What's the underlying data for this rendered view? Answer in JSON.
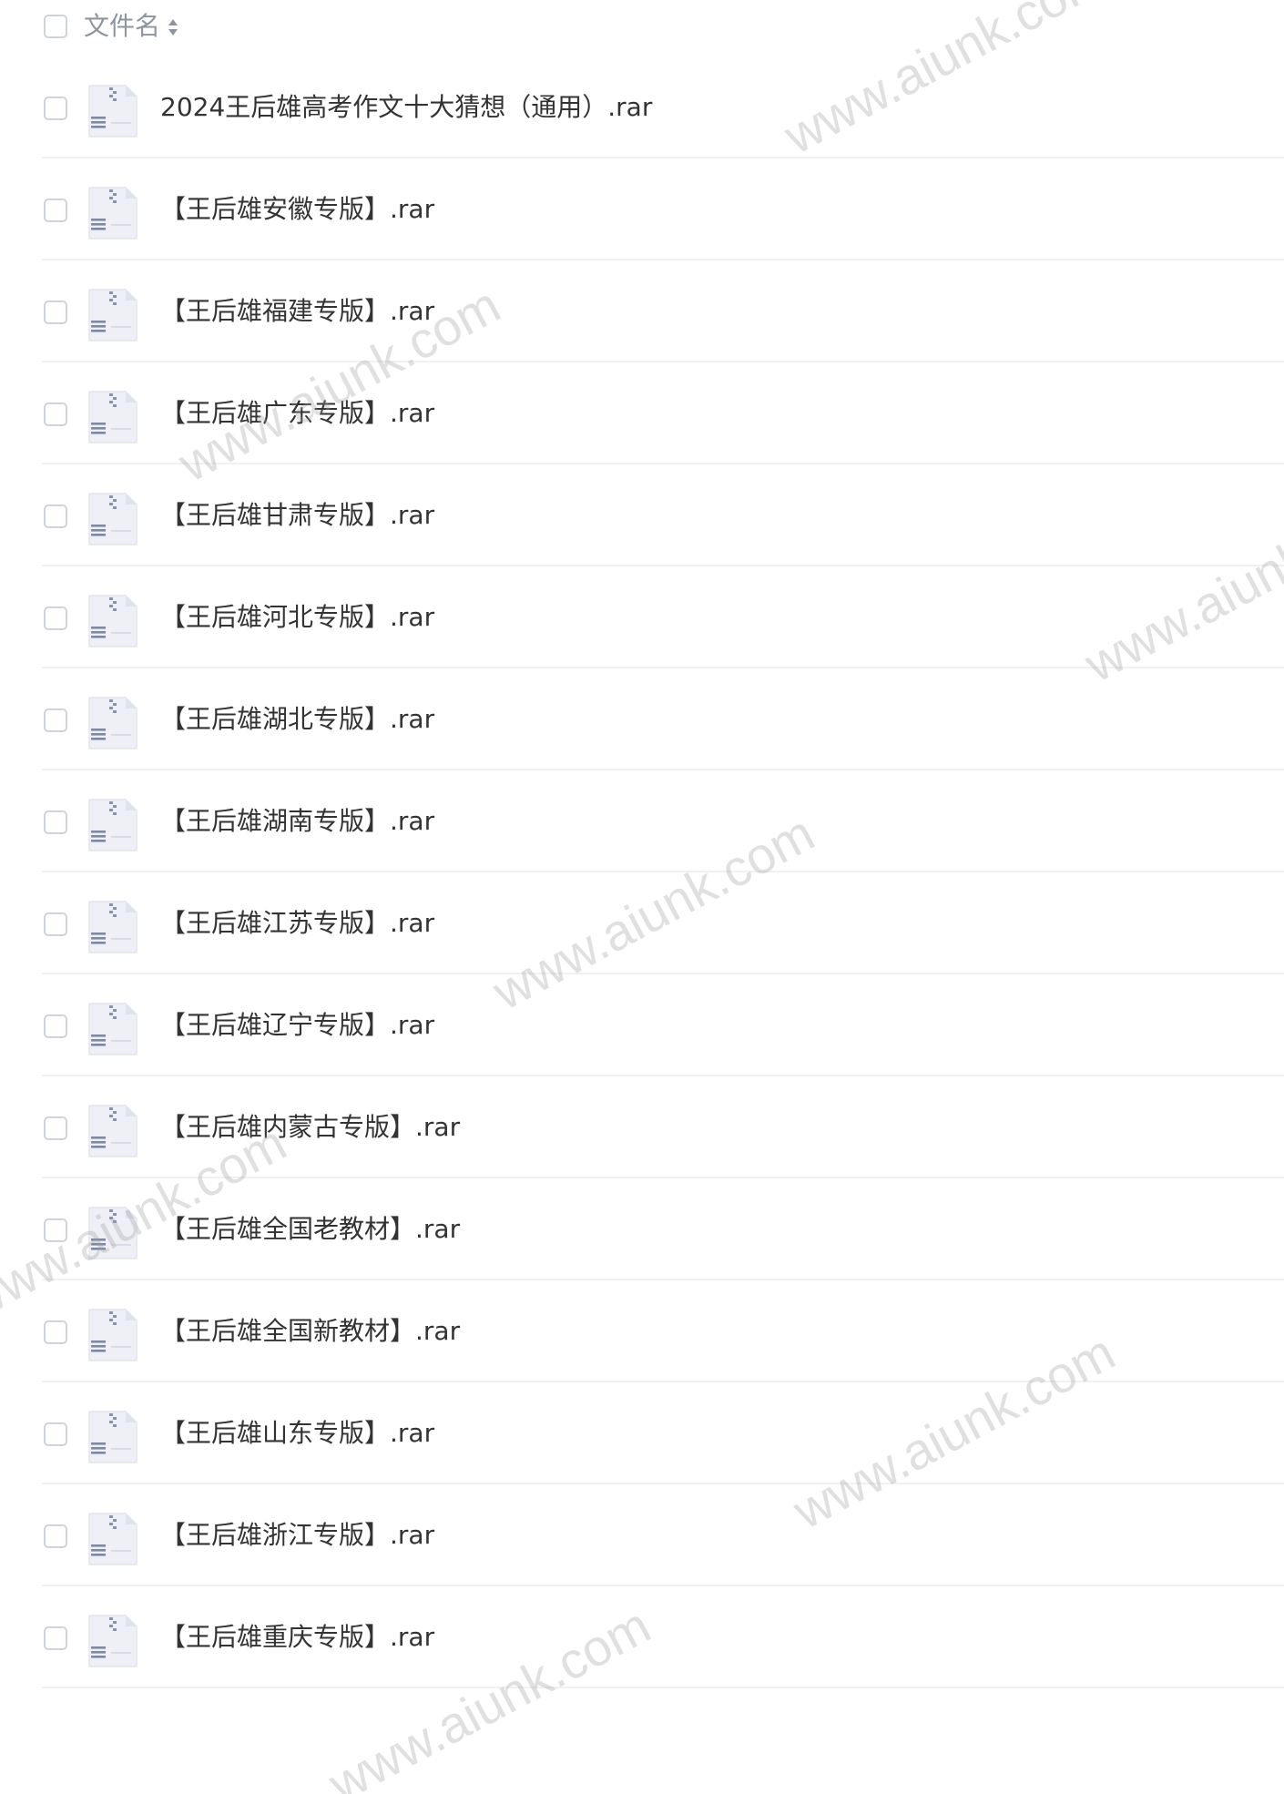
{
  "header": {
    "column_label": "文件名",
    "sort_icon": "sort-icon"
  },
  "files": [
    {
      "name": "2024王后雄高考作文十大猜想（通用）.rar",
      "icon": "archive-file-icon"
    },
    {
      "name": "【王后雄安徽专版】.rar",
      "icon": "archive-file-icon"
    },
    {
      "name": "【王后雄福建专版】.rar",
      "icon": "archive-file-icon"
    },
    {
      "name": "【王后雄广东专版】.rar",
      "icon": "archive-file-icon"
    },
    {
      "name": "【王后雄甘肃专版】.rar",
      "icon": "archive-file-icon"
    },
    {
      "name": "【王后雄河北专版】.rar",
      "icon": "archive-file-icon"
    },
    {
      "name": "【王后雄湖北专版】.rar",
      "icon": "archive-file-icon"
    },
    {
      "name": "【王后雄湖南专版】.rar",
      "icon": "archive-file-icon"
    },
    {
      "name": "【王后雄江苏专版】.rar",
      "icon": "archive-file-icon"
    },
    {
      "name": "【王后雄辽宁专版】.rar",
      "icon": "archive-file-icon"
    },
    {
      "name": "【王后雄内蒙古专版】.rar",
      "icon": "archive-file-icon"
    },
    {
      "name": "【王后雄全国老教材】.rar",
      "icon": "archive-file-icon"
    },
    {
      "name": "【王后雄全国新教材】.rar",
      "icon": "archive-file-icon"
    },
    {
      "name": "【王后雄山东专版】.rar",
      "icon": "archive-file-icon"
    },
    {
      "name": "【王后雄浙江专版】.rar",
      "icon": "archive-file-icon"
    },
    {
      "name": "【王后雄重庆专版】.rar",
      "icon": "archive-file-icon"
    }
  ],
  "watermark": {
    "text": "www.aiunk.com"
  },
  "colors": {
    "header_text": "#8f959e",
    "file_text": "#333333",
    "divider": "#f0f1f3",
    "checkbox_border": "#cfd3da"
  }
}
